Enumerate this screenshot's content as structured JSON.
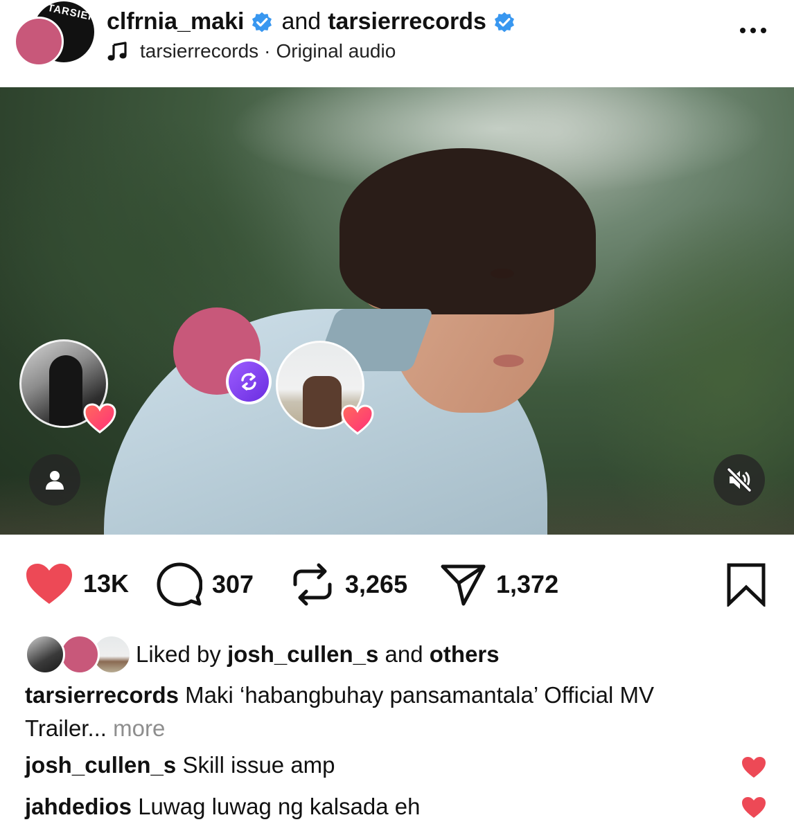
{
  "header": {
    "author1": "clfrnia_maki",
    "joiner": "and",
    "author2": "tarsierrecords",
    "avatar_logo_text": "TARSIER",
    "audio_owner": "tarsierrecords",
    "audio_separator": "·",
    "audio_label": "Original audio",
    "icons": {
      "verified": "verified-badge-icon",
      "music": "music-note-icon",
      "more": "more-options-icon"
    },
    "verified_color": "#3897f0"
  },
  "media": {
    "icons": {
      "user_tags": "user-tag-icon",
      "mute": "speaker-muted-icon",
      "repost_badge": "repost-icon",
      "like_badge": "heart-icon"
    },
    "repost_badge_color": "#7a3cf0",
    "placeholder_avatar_color": "#c8587a"
  },
  "actions": {
    "likes": "13K",
    "comments": "307",
    "reposts": "3,265",
    "shares": "1,372",
    "like_color": "#ed4956",
    "icons": {
      "like": "heart-icon",
      "comment": "comment-bubble-icon",
      "repost": "repost-icon",
      "share": "send-icon",
      "save": "bookmark-icon"
    }
  },
  "likes_summary": {
    "prefix": "Liked by",
    "user": "josh_cullen_s",
    "joiner": "and",
    "others": "others"
  },
  "caption": {
    "user": "tarsierrecords",
    "text": "Maki ‘habangbuhay pansamantala’ Official MV Trailer...",
    "more": "more"
  },
  "comments": [
    {
      "user": "josh_cullen_s",
      "text": "Skill issue amp"
    },
    {
      "user": "jahdedios",
      "text": "Luwag luwag ng kalsada eh"
    }
  ]
}
